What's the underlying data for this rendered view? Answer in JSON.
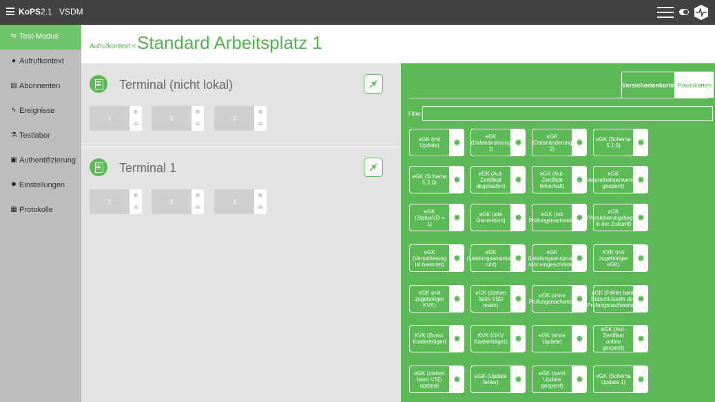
{
  "topbar": {
    "app_name": "KoPS",
    "version": "2.1",
    "module": "VSDM"
  },
  "sidebar": {
    "items": [
      {
        "label": "Test-Modus",
        "icon": "swap-icon"
      },
      {
        "label": "Aufrufkontext",
        "icon": "person-icon"
      },
      {
        "label": "Abonnenten",
        "icon": "subscribers-icon"
      },
      {
        "label": "Ereignisse",
        "icon": "lightning-icon"
      },
      {
        "label": "Testlabor",
        "icon": "lab-icon"
      },
      {
        "label": "Authentifizierung",
        "icon": "auth-icon"
      },
      {
        "label": "Einstellungen",
        "icon": "gear-icon"
      },
      {
        "label": "Protokolle",
        "icon": "log-icon"
      }
    ]
  },
  "header": {
    "context_label": "Aufrufkontext",
    "separator": "<",
    "title": "Standard Arbeitsplatz 1"
  },
  "terminals": [
    {
      "name": "Terminal (nicht lokal)",
      "slots": [
        "1",
        "2",
        "3"
      ]
    },
    {
      "name": "Terminal 1",
      "slots": [
        "1",
        "2",
        "3"
      ]
    }
  ],
  "card_panel": {
    "tabs": [
      "Versichertenkarten",
      "Praxiskarten"
    ],
    "filter_label": "Filter:",
    "filter_value": "",
    "cards": [
      "eGK (mit Update)",
      "eGK (Datenänderung 1)",
      "eGK (Datenänderung 2)",
      "eGK (Schema 5.1.0)",
      "eGK (Schema 5.2.0)",
      "eGK (Aut-Zertifikat abgelaufen)",
      "eGK (Aut-Zertifikat fehlerhaft)",
      "eGK (Gesundheitsanwendung gesperrt)",
      "eGK (StatusVD = 1)",
      "eGK (alte Generation)",
      "eGK (mit Prüfungsnachweis)",
      "eGK (Versicherungsbeginn in der Zukunft)",
      "eGK (Versicherung ist beendet)",
      "eGK (Leistungsanspruch ruht)",
      "eGK (Leistungsanspruch ruht eingeschränkt)",
      "KVK (mit zugehöriger eGK)",
      "eGK (mit zugehöriger KVK)",
      "eGK (ziehen beim VSD lesen)",
      "eGK (ohne Prüfungsnachweis)",
      "eGK (Fehler beim Entschlüsseln des Prüfungsnachweises)",
      "KVK (Sonst. Kostenträger)",
      "KVK (GKV Kostenträger)",
      "eGK (ohne Update)",
      "eGK (Aut-Zertifikat online gesperrt)",
      "eGK (ziehen beim VSD update)",
      "eGK (Update fehler)",
      "eGK (nach Update gesperrt)",
      "eGK (Schema Update 1)"
    ]
  },
  "colors": {
    "accent": "#5cba56",
    "topbar": "#424242",
    "sidebar": "#bdbdbd"
  }
}
